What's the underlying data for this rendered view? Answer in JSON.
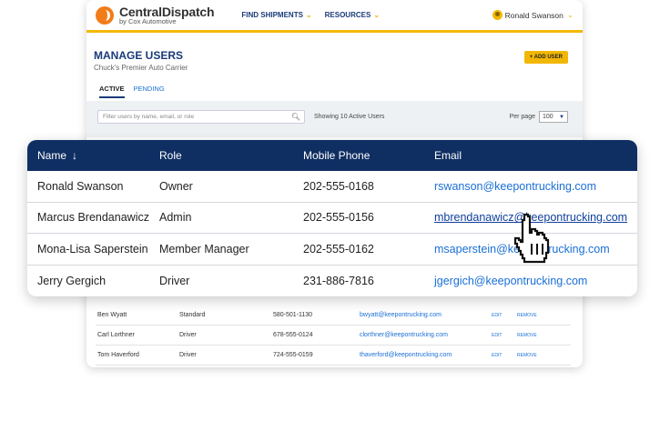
{
  "header": {
    "logo_title": "CentralDispatch",
    "logo_sub": "by Cox Automotive",
    "nav": [
      {
        "label": "FIND SHIPMENTS"
      },
      {
        "label": "RESOURCES"
      }
    ],
    "user_name": "Ronald Swanson"
  },
  "page": {
    "title": "MANAGE USERS",
    "subtitle": "Chuck's Premier Auto Carrier",
    "add_button": "+ ADD USER",
    "tabs": [
      {
        "label": "ACTIVE",
        "active": true
      },
      {
        "label": "PENDING",
        "active": false
      }
    ]
  },
  "filter": {
    "placeholder": "Filter users by name, email, or role",
    "showing": "Showing 10 Active Users",
    "per_page_label": "Per page",
    "per_page_value": "100"
  },
  "table": {
    "headers": {
      "name": "Name",
      "role": "Role",
      "phone": "Mobile Phone",
      "email": "Email"
    },
    "rows": [
      {
        "name": "Ronald Swanson",
        "role": "Owner",
        "phone": "202-555-0168",
        "email": "rswanson@keepontrucking.com"
      },
      {
        "name": "Marcus Brendanawicz",
        "role": "Admin",
        "phone": "202-555-0156",
        "email": "mbrendanawicz@keepontrucking.com"
      },
      {
        "name": "Mona-Lisa Saperstein",
        "role": "Member Manager",
        "phone": "202-555-0162",
        "email": "msaperstein@keepontrucking.com"
      },
      {
        "name": "Jerry Gergich",
        "role": "Driver",
        "phone": "231-886-7816",
        "email": "jgergich@keepontrucking.com"
      }
    ]
  },
  "bg_rows": [
    {
      "name": "Ben Wyatt",
      "role": "Standard",
      "phone": "580-501-1130",
      "email": "bwyatt@keepontrucking.com",
      "edit": "EDIT",
      "remove": "REMOVE"
    },
    {
      "name": "Carl Lorthner",
      "role": "Driver",
      "phone": "678-555-0124",
      "email": "clorthner@keepontrucking.com",
      "edit": "EDIT",
      "remove": "REMOVE"
    },
    {
      "name": "Tom Haverford",
      "role": "Driver",
      "phone": "724-555-0159",
      "email": "thaverford@keepontrucking.com",
      "edit": "EDIT",
      "remove": "REMOVE"
    }
  ],
  "colors": {
    "brand_navy": "#0f2f63",
    "accent_yellow": "#f2b705",
    "link_blue": "#1a6fd6"
  }
}
